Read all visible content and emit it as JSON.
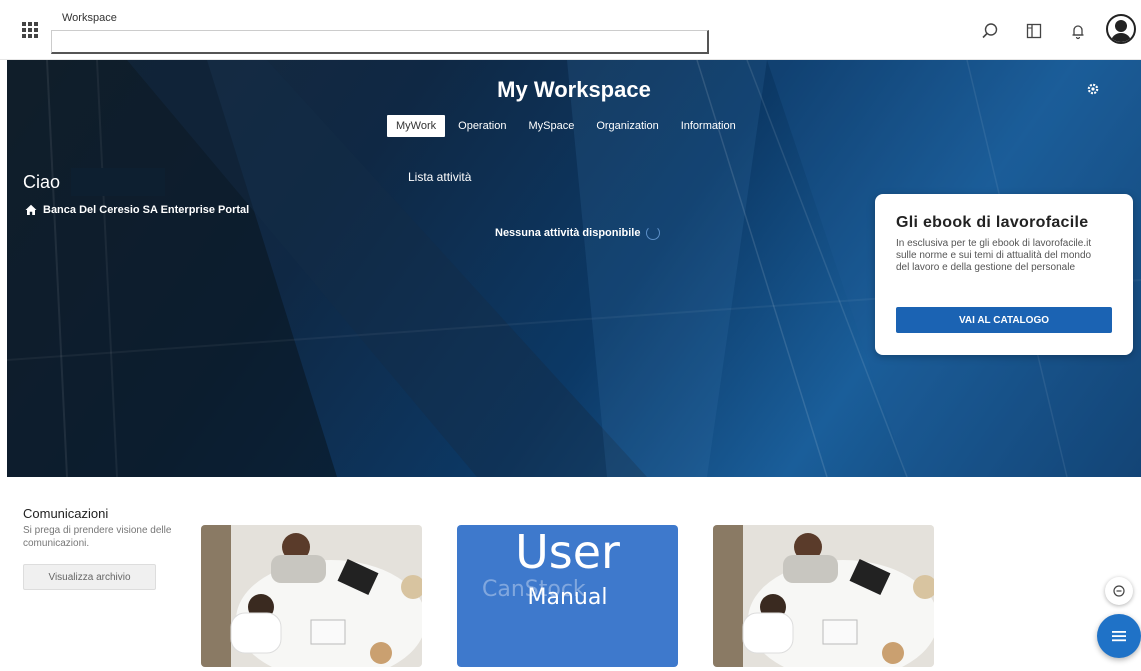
{
  "topbar": {
    "workspace_label": "Workspace",
    "search_value": "",
    "icons": [
      "apps-grid-icon",
      "search-icon",
      "panel-icon",
      "bell-icon",
      "user-avatar-icon"
    ]
  },
  "hero": {
    "title": "My Workspace",
    "tabs": [
      {
        "label": "MyWork",
        "active": true
      },
      {
        "label": "Operation",
        "active": false
      },
      {
        "label": "MySpace",
        "active": false
      },
      {
        "label": "Organization",
        "active": false
      },
      {
        "label": "Information",
        "active": false
      }
    ],
    "greeting": "Ciao",
    "portal_name": "Banca Del Ceresio SA Enterprise Portal",
    "activity_list_title": "Lista attività",
    "no_activity_text": "Nessuna attività disponibile"
  },
  "ebook_card": {
    "title": "Gli ebook di lavorofacile",
    "description": "In esclusiva per te gli ebook di lavorofacile.it sulle norme e sui temi di attualità del mondo del lavoro e della gestione del personale",
    "button_label": "VAI AL CATALOGO"
  },
  "communications": {
    "title": "Comunicazioni",
    "description": "Si prega di prendere visione delle comunicazioni.",
    "archive_button": "Visualizza archivio",
    "manual_tile": {
      "title": "User",
      "subtitle": "Manual",
      "watermark": "CanStock"
    }
  },
  "colors": {
    "accent": "#1b63b3",
    "fab": "#1f72c7",
    "manual_tile": "#3e79cc"
  }
}
